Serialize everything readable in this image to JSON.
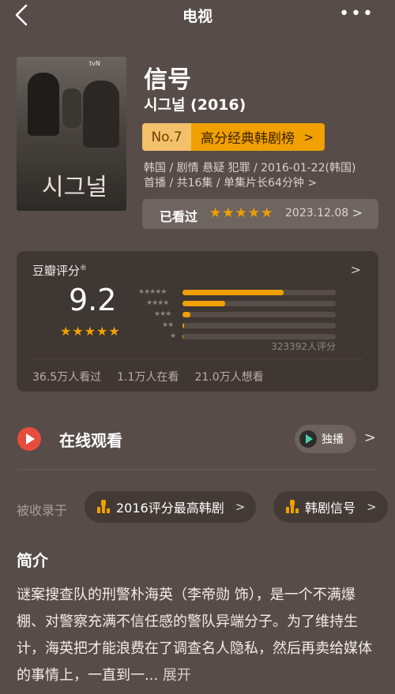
{
  "topbar": {
    "title": "电视"
  },
  "poster": {
    "title": "시그널",
    "tag": "tvN"
  },
  "show": {
    "title": "信号",
    "subtitle": "시그널 (2016)",
    "rank_no": "No.7",
    "rank_name": "高分经典韩剧榜",
    "meta_line1": "韩国 / 剧情 悬疑 犯罪 / 2016-01-22(韩国)",
    "meta_line2": "首播 / 共16集 / 单集片长64分钟"
  },
  "watched": {
    "label": "已看过",
    "stars": "★★★★★",
    "date": "2023.12.08"
  },
  "douban": {
    "label": "豆瓣评分",
    "score": "9.2",
    "score_stars": "★★★★★",
    "star_labels": [
      "★★★★★",
      "★★★★",
      "★★★",
      "★★",
      "★"
    ],
    "distribution": [
      0.66,
      0.28,
      0.05,
      0.01,
      0.005
    ],
    "votes": "323392人评分",
    "watched": "36.5万人看过",
    "watching": "1.1万人在看",
    "want": "21.0万人想看"
  },
  "online": {
    "label": "在线观看",
    "exclusive": "独播"
  },
  "included": {
    "label": "被收录于",
    "chips": [
      "2016评分最高韩剧",
      "韩剧信号"
    ]
  },
  "intro": {
    "title": "简介",
    "text": "谜案搜查队的刑警朴海英（李帝勋 饰），是一个不满爆棚、对警察充满不信任感的警队异端分子。为了维持生计，海英把才能浪费在了调查名人隐私，然后再卖给媒体的事情上，一直到一...",
    "expand": " 展开"
  },
  "colors": {
    "accent": "#f0a000",
    "background": "#574c47",
    "card": "#3f3733"
  }
}
